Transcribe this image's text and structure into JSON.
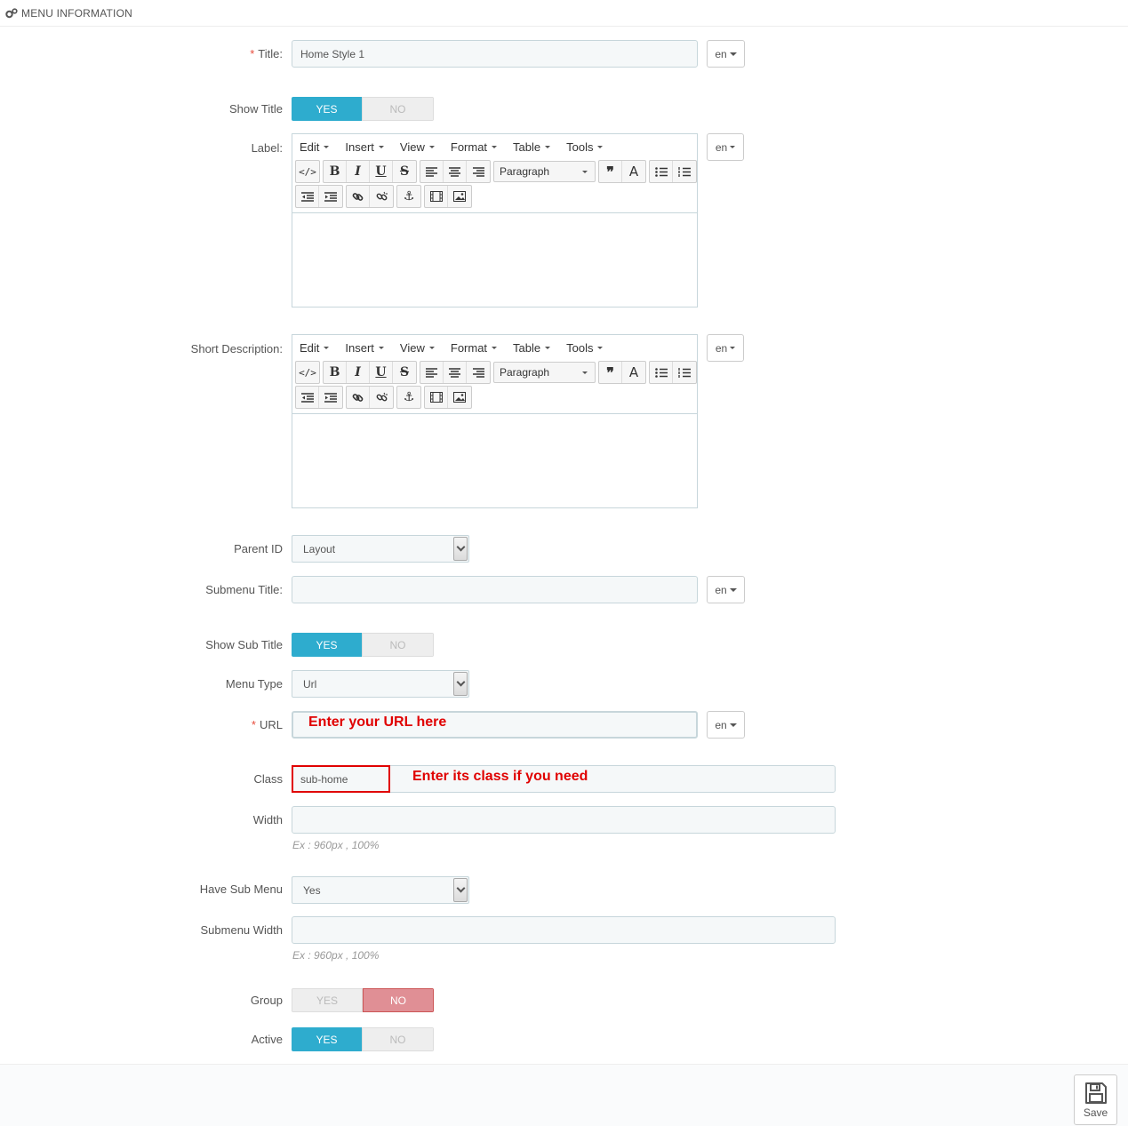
{
  "panel": {
    "title": "MENU INFORMATION",
    "icon": "gears-icon"
  },
  "form": {
    "title": {
      "label": "Title:",
      "required_mark": "*",
      "value": "Home Style 1",
      "lang": "en"
    },
    "show_title": {
      "label": "Show Title",
      "yes": "YES",
      "no": "NO",
      "selected": "YES"
    },
    "label_field": {
      "label": "Label:",
      "lang": "en"
    },
    "short_description": {
      "label": "Short Description:",
      "lang": "en"
    },
    "parent_id": {
      "label": "Parent ID",
      "value": "Layout"
    },
    "submenu_title": {
      "label": "Submenu Title:",
      "value": "",
      "lang": "en"
    },
    "show_sub_title": {
      "label": "Show Sub Title",
      "yes": "YES",
      "no": "NO",
      "selected": "YES"
    },
    "menu_type": {
      "label": "Menu Type",
      "value": "Url"
    },
    "url": {
      "label": "URL",
      "required_mark": "*",
      "value": "",
      "lang": "en"
    },
    "class": {
      "label": "Class",
      "value": "sub-home"
    },
    "width": {
      "label": "Width",
      "value": "",
      "hint": "Ex : 960px , 100%"
    },
    "have_sub_menu": {
      "label": "Have Sub Menu",
      "value": "Yes"
    },
    "submenu_width": {
      "label": "Submenu Width",
      "value": "",
      "hint": "Ex : 960px , 100%"
    },
    "group": {
      "label": "Group",
      "yes": "YES",
      "no": "NO",
      "selected": "NO"
    },
    "active": {
      "label": "Active",
      "yes": "YES",
      "no": "NO",
      "selected": "YES"
    }
  },
  "editor": {
    "menus": [
      "Edit",
      "Insert",
      "View",
      "Format",
      "Table",
      "Tools"
    ],
    "block_format": "Paragraph",
    "toolbar_icons": [
      "source-code-icon",
      "bold-icon",
      "italic-icon",
      "underline-icon",
      "strikethrough-icon",
      "align-left-icon",
      "align-center-icon",
      "align-right-icon",
      "blockquote-icon",
      "text-color-icon",
      "bullet-list-icon",
      "numbered-list-icon",
      "outdent-icon",
      "indent-icon",
      "link-icon",
      "unlink-icon",
      "anchor-icon",
      "media-icon",
      "image-icon"
    ]
  },
  "annotations": {
    "url_note": "Enter your URL here",
    "class_note": "Enter its class if you need"
  },
  "footer": {
    "save_label": "Save",
    "save_icon": "floppy-disk-icon"
  },
  "colors": {
    "toggle_on": "#2eacce",
    "toggle_no_active": "#e08f95",
    "annotation": "#e00000",
    "required": "#e74c3c"
  }
}
